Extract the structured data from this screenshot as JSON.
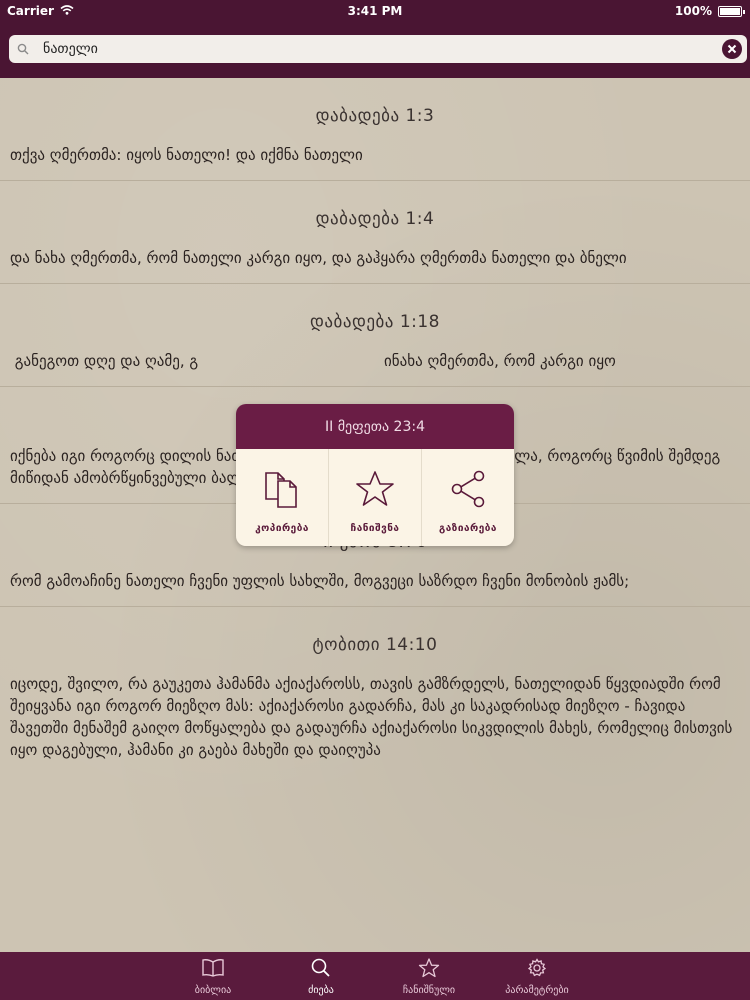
{
  "status_bar": {
    "carrier": "Carrier",
    "time": "3:41 PM",
    "battery": "100%"
  },
  "search": {
    "value": "ნათელი",
    "placeholder": ""
  },
  "entries": [
    {
      "ref": "დაბადება   1:3",
      "text": "თქვა ღმერთმა: იყოს ნათელი! და იქმნა ნათელი"
    },
    {
      "ref": "დაბადება   1:4",
      "text": "და ნახა ღმერთმა, რომ ნათელი კარგი იყო, და გაჰყარა ღმერთმა ნათელი და ბნელი"
    },
    {
      "ref": "დაბადება   1:18",
      "text": " განეგოთ დღე და ღამე, გ                                       ინახა ღმერთმა, რომ კარგი იყო"
    },
    {
      "ref": "",
      "text": "იქნება იგი როგორც დილის ნათელი მზის ამოსვლისას, უღრუბლო დილა, როგორც წვიმის შემდეგ მიწიდან ამობრწყინვებული ბალახი"
    },
    {
      "ref": "II ეზრა   8:76",
      "text": " რომ გამოაჩინე ნათელი ჩვენი უფლის სახლში, მოგვეცი საზრდო ჩვენი მონობის ჟამს;"
    },
    {
      "ref": "ტობითი   14:10",
      "text": " იცოდე, შვილო, რა გაუკეთა ჰამანმა აქიაქაროსს, თავის გამზრდელს, ნათელიდან წყვდიადში რომ შეიყვანა იგი როგორ მიეზღო მას: აქიაქაროსი გადარჩა, მას კი საკადრისად მიეზღო - ჩავიდა შავეთში მენაშემ გაიღო მოწყალება და გადაურჩა აქიაქაროსი სიკვდილის მახეს, რომელიც მისთვის იყო დაგებული, ჰამანი კი გაება მახეში და დაიღუპა"
    }
  ],
  "popup": {
    "title": "II მეფეთა  23:4",
    "actions": [
      {
        "label": "კოპირება",
        "icon": "copy-icon"
      },
      {
        "label": "ჩანიშვნა",
        "icon": "star-icon"
      },
      {
        "label": "გაზიარება",
        "icon": "share-icon"
      }
    ]
  },
  "tabs": [
    {
      "label": "ბიბლია",
      "icon": "book-icon"
    },
    {
      "label": "ძიება",
      "icon": "search-icon"
    },
    {
      "label": "ჩანიშნული",
      "icon": "star-icon"
    },
    {
      "label": "პარამეტრები",
      "icon": "gear-icon"
    }
  ],
  "colors": {
    "brand": "#4a1533",
    "popup_head": "#6a1d45",
    "popup_body": "#fbf4e6",
    "paper": "#cdc4b3"
  }
}
